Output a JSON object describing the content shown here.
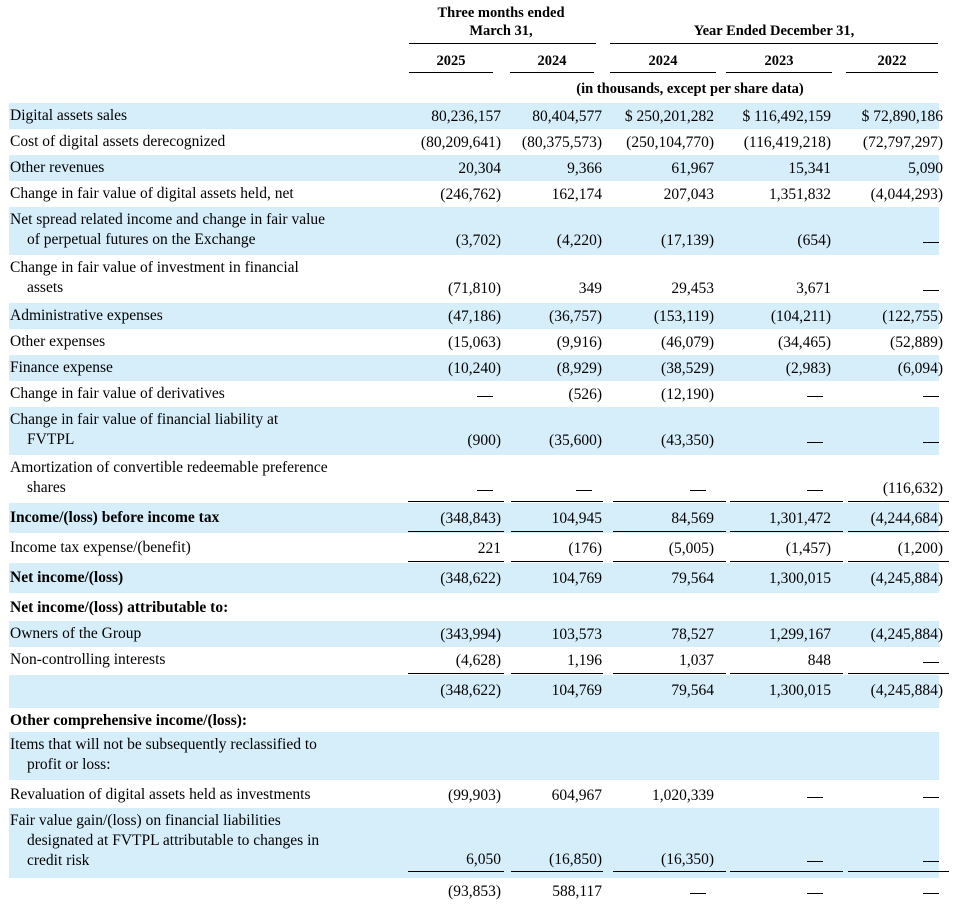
{
  "header": {
    "group_q": "Three months ended\nMarch 31,",
    "group_y": "Year Ended December 31,",
    "columns": [
      "2025",
      "2024",
      "2024",
      "2023",
      "2022"
    ],
    "units": "(in thousands, except per share data)"
  },
  "rows": [
    {
      "label": "Digital assets sales",
      "values": [
        "80,236,157",
        "80,404,577",
        "$ 250,201,282",
        "$ 116,492,159",
        "$ 72,890,186"
      ]
    },
    {
      "label": "Cost of digital assets derecognized",
      "values": [
        "(80,209,641)",
        "(80,375,573)",
        "(250,104,770)",
        "(116,419,218)",
        "(72,797,297)"
      ]
    },
    {
      "label": "Other revenues",
      "values": [
        "20,304",
        "9,366",
        "61,967",
        "15,341",
        "5,090"
      ]
    },
    {
      "label": "Change in fair value of digital assets held, net",
      "values": [
        "(246,762)",
        "162,174",
        "207,043",
        "1,351,832",
        "(4,044,293)"
      ]
    },
    {
      "label": "Net spread related income and change in fair value",
      "label2": "of perpetual futures on the Exchange",
      "values": [
        "(3,702)",
        "(4,220)",
        "(17,139)",
        "(654)",
        "—"
      ]
    },
    {
      "label": "Change in fair value of investment in financial",
      "label2": "assets",
      "values": [
        "(71,810)",
        "349",
        "29,453",
        "3,671",
        "—"
      ]
    },
    {
      "label": "Administrative expenses",
      "values": [
        "(47,186)",
        "(36,757)",
        "(153,119)",
        "(104,211)",
        "(122,755)"
      ]
    },
    {
      "label": "Other expenses",
      "values": [
        "(15,063)",
        "(9,916)",
        "(46,079)",
        "(34,465)",
        "(52,889)"
      ]
    },
    {
      "label": "Finance expense",
      "values": [
        "(10,240)",
        "(8,929)",
        "(38,529)",
        "(2,983)",
        "(6,094)"
      ]
    },
    {
      "label": "Change in fair value of derivatives",
      "values": [
        "—",
        "(526)",
        "(12,190)",
        "—",
        "—"
      ]
    },
    {
      "label": "Change in fair value of financial liability at",
      "label2": "FVTPL",
      "values": [
        "(900)",
        "(35,600)",
        "(43,350)",
        "—",
        "—"
      ]
    },
    {
      "label": "Amortization of convertible redeemable preference",
      "label2": "shares",
      "values": [
        "—",
        "—",
        "—",
        "—",
        "(116,632)"
      ]
    },
    {
      "label": "Income/(loss) before income tax",
      "bold": true,
      "values": [
        "(348,843)",
        "104,945",
        "84,569",
        "1,301,472",
        "(4,244,684)"
      ]
    },
    {
      "label": "Income tax expense/(benefit)",
      "values": [
        "221",
        "(176)",
        "(5,005)",
        "(1,457)",
        "(1,200)"
      ]
    },
    {
      "label": "Net income/(loss)",
      "bold": true,
      "values": [
        "(348,622)",
        "104,769",
        "79,564",
        "1,300,015",
        "(4,245,884)"
      ]
    },
    {
      "label": "Net income/(loss) attributable to:",
      "bold": true,
      "values": [
        "",
        "",
        "",
        "",
        ""
      ]
    },
    {
      "label": "Owners of the Group",
      "values": [
        "(343,994)",
        "103,573",
        "78,527",
        "1,299,167",
        "(4,245,884)"
      ]
    },
    {
      "label": "Non-controlling interests",
      "values": [
        "(4,628)",
        "1,196",
        "1,037",
        "848",
        "—"
      ]
    },
    {
      "label": "",
      "values": [
        "(348,622)",
        "104,769",
        "79,564",
        "1,300,015",
        "(4,245,884)"
      ]
    },
    {
      "label": "Other comprehensive income/(loss):",
      "bold": true,
      "values": [
        "",
        "",
        "",
        "",
        ""
      ]
    },
    {
      "label": "Items that will not be subsequently reclassified to",
      "label2": "profit or loss:",
      "values": [
        "",
        "",
        "",
        "",
        ""
      ]
    },
    {
      "label": "Revaluation of digital assets held as investments",
      "values": [
        "(99,903)",
        "604,967",
        "1,020,339",
        "—",
        "—"
      ]
    },
    {
      "label": "Fair value gain/(loss) on financial liabilities",
      "label2": "designated at FVTPL attributable to changes in",
      "label3": "credit risk",
      "values": [
        "6,050",
        "(16,850)",
        "(16,350)",
        "—",
        "—"
      ]
    },
    {
      "label": "",
      "values": [
        "(93,853)",
        "588,117",
        "—",
        "—",
        "—"
      ]
    }
  ]
}
